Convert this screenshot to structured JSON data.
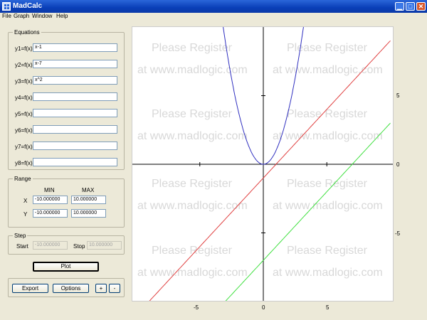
{
  "window": {
    "title": "MadCalc"
  },
  "titlebar_buttons": {
    "minimize": "▁",
    "maximize": "□",
    "close": "✕"
  },
  "menu": [
    "File",
    "Graph",
    "Window",
    "Help"
  ],
  "equations": {
    "title": "Equations",
    "rows": [
      {
        "label": "y1=f(x)",
        "value": "x-1"
      },
      {
        "label": "y2=f(x)",
        "value": "x-7"
      },
      {
        "label": "y3=f(x)",
        "value": "x^2"
      },
      {
        "label": "y4=f(x)",
        "value": ""
      },
      {
        "label": "y5=f(x)",
        "value": ""
      },
      {
        "label": "y6=f(x)",
        "value": ""
      },
      {
        "label": "y7=f(x)",
        "value": ""
      },
      {
        "label": "y8=f(x)",
        "value": ""
      }
    ]
  },
  "range": {
    "title": "Range",
    "min_header": "MIN",
    "max_header": "MAX",
    "x_label": "X",
    "y_label": "Y",
    "x_min": "-10.000000",
    "x_max": "10.000000",
    "y_min": "-10.000000",
    "y_max": "10.000000"
  },
  "step": {
    "title": "Step",
    "start_label": "Start",
    "start_value": "-10.000000",
    "stop_label": "Stop",
    "stop_value": "10.000000"
  },
  "buttons": {
    "plot": "Plot",
    "export": "Export",
    "options": "Options",
    "zoom_in": "+",
    "zoom_out": "-"
  },
  "watermark": {
    "line1": "Please Register",
    "line2": "at www.madlogic.com"
  },
  "graph": {
    "x_ticks": [
      "-5",
      "0",
      "5"
    ],
    "y_ticks": [
      "5",
      "0",
      "-5"
    ],
    "colors": {
      "y1": "#e04040",
      "y2": "#40e040",
      "y3": "#3030c0",
      "axis": "#000000"
    }
  }
}
